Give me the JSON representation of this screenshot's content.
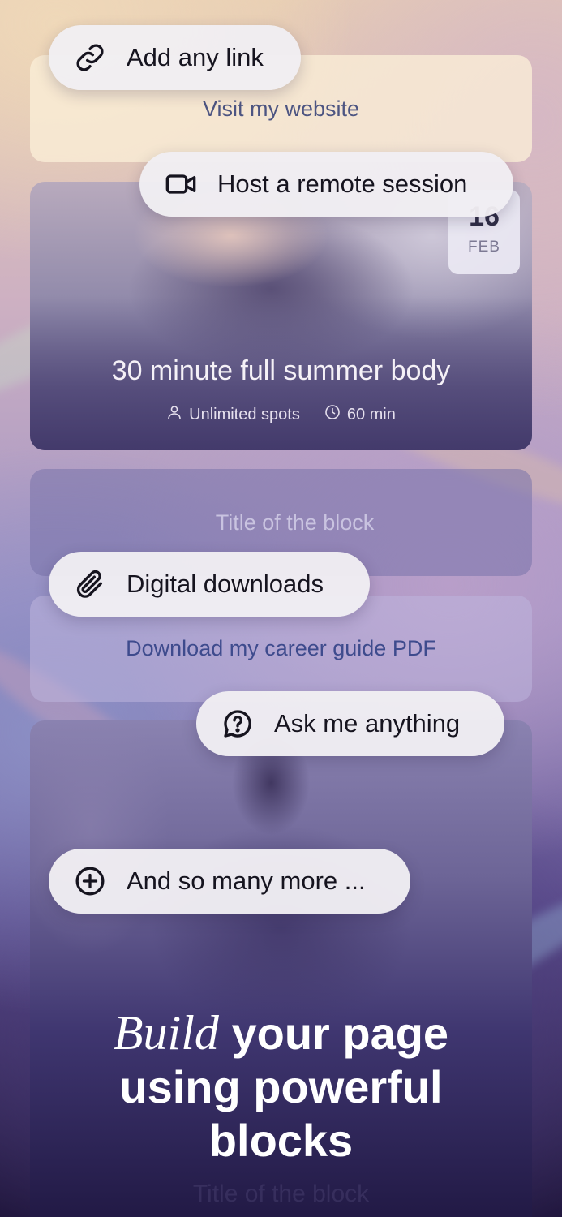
{
  "cards": {
    "link_card_text": "Visit my website",
    "event": {
      "date_day": "16",
      "date_month": "FEB",
      "title": "30 minute full summer body",
      "spots": "Unlimited spots",
      "duration": "60 min"
    },
    "title_card_text": "Title of the block",
    "download_card_text": "Download my career guide PDF",
    "ghost_text": "Title of the block"
  },
  "pills": {
    "add_link": {
      "label": "Add any link",
      "icon": "link-icon"
    },
    "remote_session": {
      "label": "Host a remote session",
      "icon": "video-camera-icon"
    },
    "digital_downloads": {
      "label": "Digital downloads",
      "icon": "paperclip-icon"
    },
    "ask_anything": {
      "label": "Ask me anything",
      "icon": "question-bubble-icon"
    },
    "and_more": {
      "label": "And so many more ...",
      "icon": "plus-circle-icon"
    }
  },
  "headline": {
    "accent": "Build",
    "line1_rest": " your page",
    "line2": "using powerful",
    "line3": "blocks"
  },
  "colors": {
    "pill_bg": "#f0eef3",
    "link_card_text": "#4d5582",
    "download_card_text": "#3e4b8d",
    "headline": "#ffffff"
  }
}
